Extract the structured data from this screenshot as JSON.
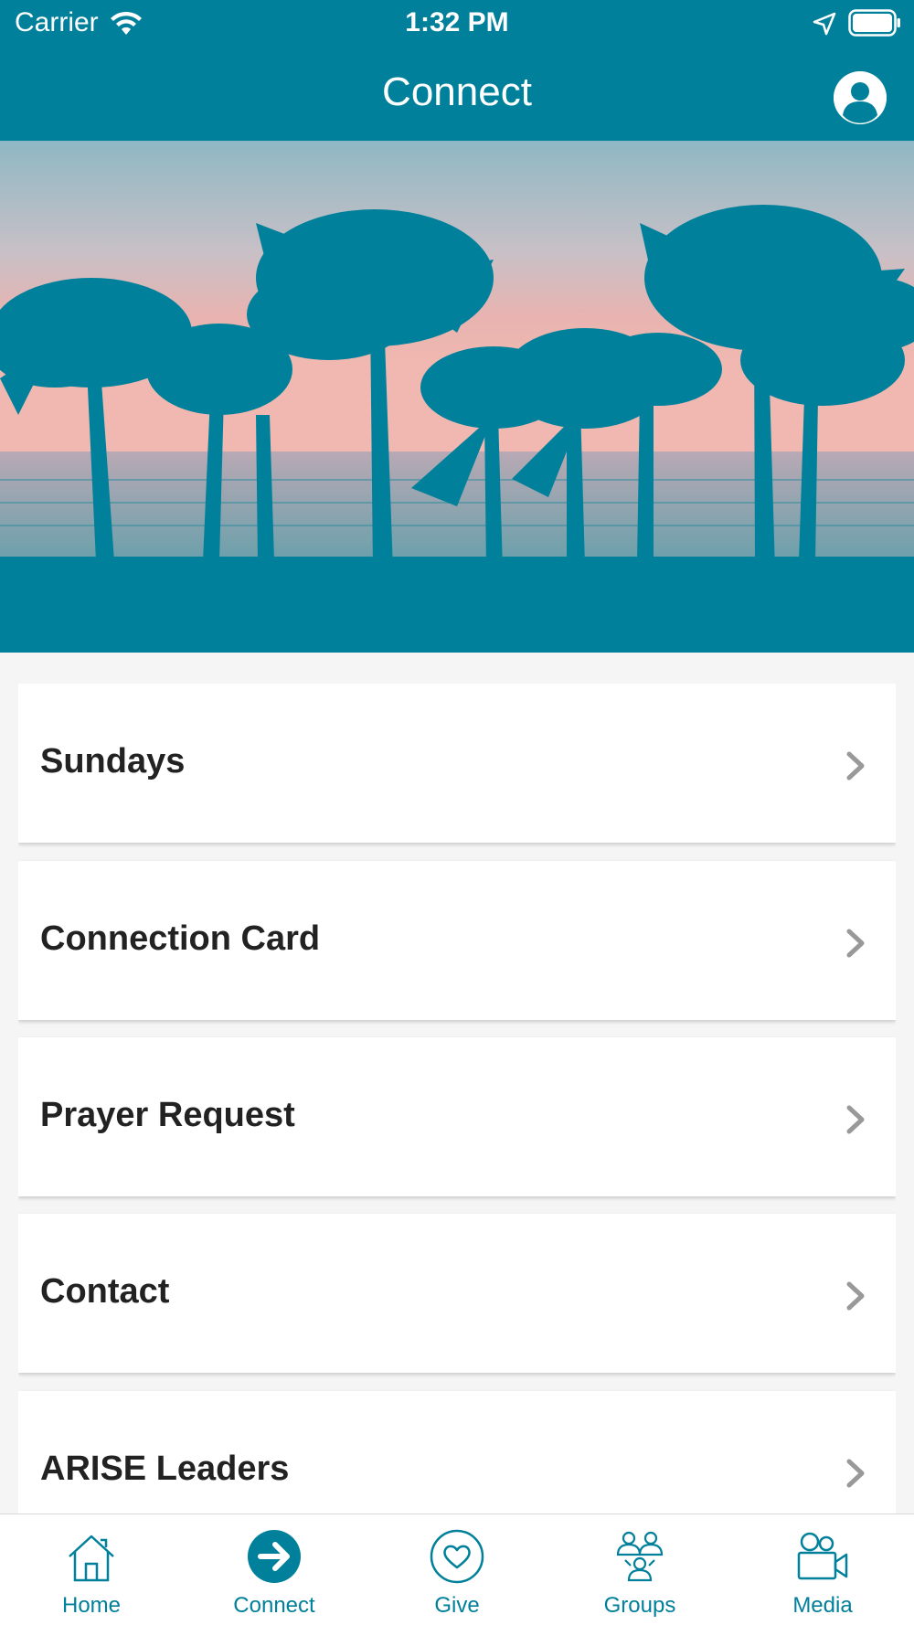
{
  "status_bar": {
    "carrier": "Carrier",
    "time": "1:32 PM"
  },
  "header": {
    "title": "Connect"
  },
  "menu": {
    "items": [
      {
        "label": "Sundays"
      },
      {
        "label": "Connection Card"
      },
      {
        "label": "Prayer Request"
      },
      {
        "label": "Contact"
      },
      {
        "label": "ARISE Leaders"
      }
    ]
  },
  "tabbar": {
    "items": [
      {
        "label": "Home",
        "icon": "home-icon"
      },
      {
        "label": "Connect",
        "icon": "arrow-right-circle-icon",
        "active": true
      },
      {
        "label": "Give",
        "icon": "heart-circle-icon"
      },
      {
        "label": "Groups",
        "icon": "groups-icon"
      },
      {
        "label": "Media",
        "icon": "video-camera-icon"
      }
    ]
  },
  "colors": {
    "brand": "#00809a",
    "card_bg": "#ffffff",
    "chevron": "#999999"
  }
}
